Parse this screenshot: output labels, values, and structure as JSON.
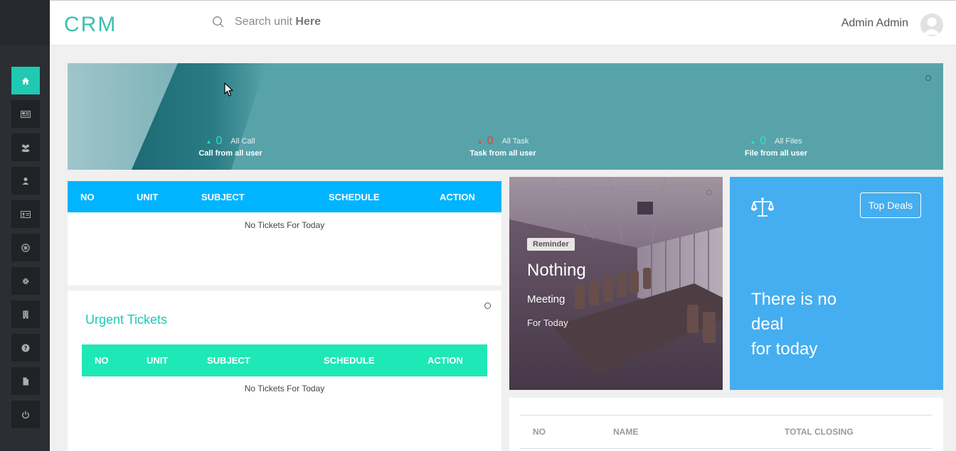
{
  "topbar": {
    "brand": "CRM",
    "search_prefix": "Search unit ",
    "search_bold": "Here",
    "user_name": "Admin Admin"
  },
  "sidebar": {
    "items": [
      {
        "name": "home",
        "icon": "home-icon",
        "active": true
      },
      {
        "name": "news",
        "icon": "newspaper-icon"
      },
      {
        "name": "users",
        "icon": "users-icon"
      },
      {
        "name": "user",
        "icon": "user-icon"
      },
      {
        "name": "id-card",
        "icon": "id-card-icon"
      },
      {
        "name": "support",
        "icon": "asterisk-icon"
      },
      {
        "name": "settings",
        "icon": "gear-icon"
      },
      {
        "name": "building",
        "icon": "building-icon"
      },
      {
        "name": "help",
        "icon": "question-icon"
      },
      {
        "name": "file",
        "icon": "file-icon"
      },
      {
        "name": "logout",
        "icon": "power-icon"
      }
    ]
  },
  "banner": {
    "stats": [
      {
        "value": "0",
        "label": "All Call",
        "sub": "Call from all user",
        "trend": "up"
      },
      {
        "value": "0",
        "label": "All Task",
        "sub": "Task from all user",
        "trend": "down"
      },
      {
        "value": "0",
        "label": "All Files",
        "sub": "File from all user",
        "trend": "up"
      }
    ]
  },
  "tickets": {
    "columns": [
      "NO",
      "UNIT",
      "SUBJECT",
      "SCHEDULE",
      "ACTION"
    ],
    "empty": "No Tickets For Today"
  },
  "urgent": {
    "title": "Urgent Tickets",
    "columns": [
      "NO",
      "UNIT",
      "SUBJECT",
      "SCHEDULE",
      "ACTION"
    ],
    "empty": "No Tickets For Today"
  },
  "reminder": {
    "badge": "Reminder",
    "title": "Nothing",
    "subtitle": "Meeting",
    "subtitle2": "For Today"
  },
  "deals": {
    "button": "Top Deals",
    "line1": "There is no",
    "line2": "deal",
    "line3": "for today"
  },
  "closing": {
    "columns": [
      "NO",
      "NAME",
      "TOTAL CLOSING"
    ]
  },
  "colors": {
    "accent": "#1fc9b2",
    "ticket_header": "#00b4ff",
    "urgent_header": "#1fe8b7",
    "deal_bg": "#45aef0",
    "banner": "#58a3aa"
  }
}
